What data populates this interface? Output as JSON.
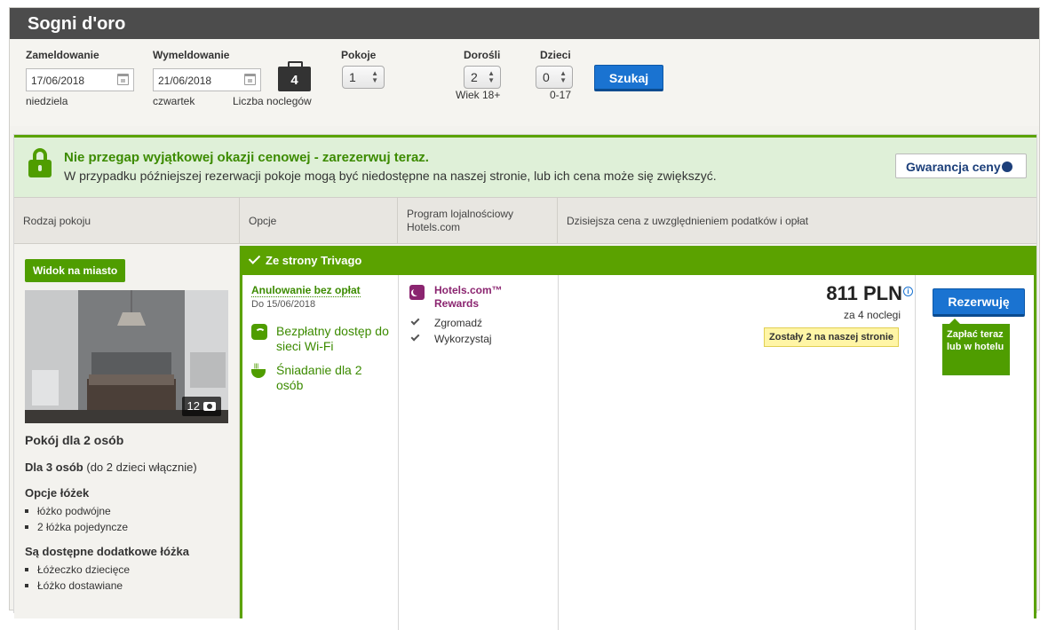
{
  "header": {
    "title": "Sogni d'oro"
  },
  "search": {
    "checkin_label": "Zameldowanie",
    "checkin_value": "17/06/2018",
    "checkin_day": "niedziela",
    "checkout_label": "Wymeldowanie",
    "checkout_value": "21/06/2018",
    "checkout_day": "czwartek",
    "nights_value": "4",
    "nights_label": "Liczba noclegów",
    "rooms_label": "Pokoje",
    "rooms_value": "1",
    "adults_label": "Dorośli",
    "adults_value": "2",
    "adults_note": "Wiek 18+",
    "children_label": "Dzieci",
    "children_value": "0",
    "children_note": "0-17",
    "search_button": "Szukaj"
  },
  "urgency": {
    "title": "Nie przegap wyjątkowej okazji cenowej - zarezerwuj teraz.",
    "text": "W przypadku późniejszej rezerwacji pokoje mogą być niedostępne na naszej stronie, lub ich cena może się zwiększyć.",
    "guarantee_button": "Gwarancja ceny"
  },
  "table_headers": {
    "room_type": "Rodzaj pokoju",
    "options": "Opcje",
    "loyalty": "Program lojalnościowy Hotels.com",
    "price": "Dzisiejsza cena z uwzględnieniem podatków i opłat"
  },
  "room": {
    "view_badge": "Widok na miasto",
    "photo_count": "12",
    "name": "Pokój dla 2 osób",
    "capacity_bold": "Dla 3 osób",
    "capacity_note": "(do 2 dzieci włącznie)",
    "bed_options_title": "Opcje łóżek",
    "bed_options": [
      "łóżko podwójne",
      "2 łóżka pojedyncze"
    ],
    "extra_beds_title": "Są dostępne dodatkowe łóżka",
    "extra_beds": [
      "Łóżeczko dziecięce",
      "Łóżko dostawiane"
    ]
  },
  "offer": {
    "source": "Ze strony Trivago",
    "cancel": "Anulowanie bez opłat",
    "cancel_date": "Do 15/06/2018",
    "amenities": [
      "Bezpłatny dostęp do sieci Wi-Fi",
      "Śniadanie dla 2 osób"
    ],
    "loyalty_name": "Hotels.com™ Rewards",
    "loyalty_items": [
      "Zgromadź",
      "Wykorzystaj"
    ],
    "price": "811 PLN",
    "price_info": "i",
    "price_nights": "za 4 noclegi",
    "scarcity": "Zostały 2 na naszej stronie",
    "book_button": "Rezerwuję",
    "pay_note": "Zapłać teraz lub w hotelu"
  },
  "colors": {
    "green": "#5ba200",
    "blue": "#1a73d1",
    "header": "#4c4c4c",
    "rewards": "#8b2570"
  }
}
